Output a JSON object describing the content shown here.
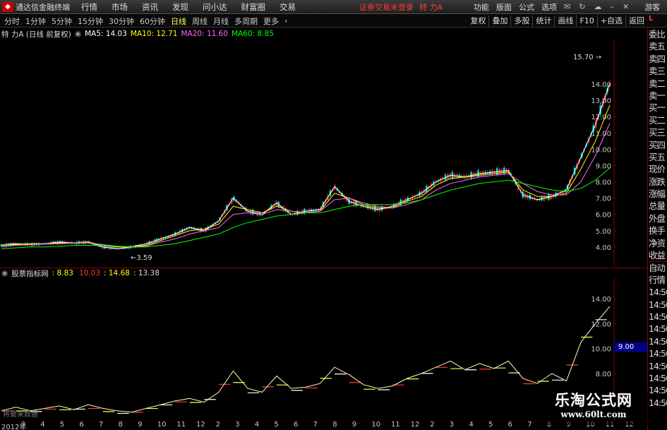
{
  "menubar": {
    "app_title": "通达信金融终端",
    "items": [
      "行情",
      "市场",
      "资讯",
      "发现",
      "问小达",
      "财富圈",
      "交易"
    ],
    "notice": "证券交易未登录",
    "stock_name": "特 力A",
    "right_items": [
      "功能",
      "版面",
      "公式",
      "选项"
    ],
    "guest": "游客"
  },
  "toolbar": {
    "periods": [
      "分时",
      "1分钟",
      "5分钟",
      "15分钟",
      "30分钟",
      "60分钟",
      "日线",
      "周线",
      "月线",
      "多周期",
      "更多"
    ],
    "active_period": "日线",
    "buttons": [
      "复权",
      "叠加",
      "多股",
      "统计",
      "画线",
      "F10",
      "+自选",
      "返回"
    ],
    "corner": "L"
  },
  "main_info": {
    "title": "特 力A (日线 前复权)",
    "ma5": "MA5: 14.03",
    "ma10": "MA10: 12.71",
    "ma20": "MA20: 11.60",
    "ma60": "MA60: 8.85"
  },
  "sub_info": {
    "title": "股票指标网",
    "v1": ": 8.83",
    "v2": "10.03",
    "v3": ": 14.68",
    "v4": ": 13.38"
  },
  "annotations": {
    "high": "15.70",
    "low": "3.59",
    "highlight": "9.00",
    "bottom_text": "将要来数据"
  },
  "colors": {
    "up": "#ff3b3b",
    "down": "#00e0e0",
    "ma5": "#ffffff",
    "ma10": "#ffff00",
    "ma20": "#ff66ff",
    "ma60": "#00ff00"
  },
  "chart_data": [
    {
      "type": "candlestick",
      "title": "特 力A (日线 前复权)",
      "ylim": [
        3.3,
        16.3
      ],
      "yticks": [
        "14.00",
        "13.00",
        "12.00",
        "11.00",
        "10.00",
        "9.00",
        "8.00",
        "7.00",
        "6.00",
        "5.00",
        "4.00"
      ],
      "series": [
        {
          "name": "MA5",
          "values": [
            4.1,
            4.2,
            4.15,
            4.2,
            4.3,
            4.25,
            4.3,
            4.0,
            3.9,
            4.0,
            4.2,
            4.5,
            4.8,
            5.2,
            5.0,
            5.6,
            7.0,
            6.2,
            6.0,
            6.7,
            6.0,
            6.2,
            6.3,
            7.7,
            6.8,
            6.5,
            6.3,
            6.5,
            6.9,
            7.3,
            8.0,
            8.4,
            8.3,
            8.5,
            8.6,
            8.7,
            7.2,
            6.9,
            7.1,
            7.5,
            9.5,
            11.5,
            14.03
          ]
        },
        {
          "name": "MA10",
          "values": [
            4.1,
            4.15,
            4.2,
            4.2,
            4.25,
            4.25,
            4.3,
            4.1,
            4.0,
            4.0,
            4.1,
            4.4,
            4.7,
            5.0,
            5.1,
            5.4,
            6.5,
            6.3,
            6.1,
            6.5,
            6.2,
            6.1,
            6.2,
            7.3,
            7.0,
            6.6,
            6.4,
            6.4,
            6.8,
            7.1,
            7.8,
            8.2,
            8.3,
            8.4,
            8.5,
            8.6,
            7.5,
            7.1,
            7.1,
            7.3,
            8.8,
            10.5,
            12.71
          ]
        },
        {
          "name": "MA20",
          "values": [
            4.0,
            4.1,
            4.15,
            4.2,
            4.2,
            4.25,
            4.25,
            4.15,
            4.05,
            4.0,
            4.05,
            4.3,
            4.5,
            4.8,
            5.0,
            5.2,
            6.0,
            6.1,
            6.0,
            6.3,
            6.2,
            6.1,
            6.2,
            6.9,
            7.0,
            6.7,
            6.5,
            6.4,
            6.6,
            6.9,
            7.5,
            7.9,
            8.1,
            8.3,
            8.4,
            8.5,
            7.9,
            7.4,
            7.2,
            7.2,
            8.0,
            9.6,
            11.6
          ]
        },
        {
          "name": "MA60",
          "values": [
            3.9,
            3.95,
            4.0,
            4.0,
            4.05,
            4.1,
            4.1,
            4.1,
            4.05,
            4.0,
            4.0,
            4.1,
            4.2,
            4.4,
            4.6,
            4.8,
            5.2,
            5.5,
            5.7,
            5.9,
            6.0,
            6.1,
            6.1,
            6.3,
            6.5,
            6.6,
            6.6,
            6.6,
            6.7,
            6.9,
            7.2,
            7.5,
            7.7,
            7.9,
            8.0,
            8.1,
            7.9,
            7.7,
            7.5,
            7.4,
            7.6,
            8.1,
            8.85
          ]
        }
      ]
    },
    {
      "type": "line",
      "title": "股票指标网",
      "ylim": [
        4.6,
        15.3
      ],
      "yticks": [
        "14.00",
        "12.00",
        "10.00",
        "8.00"
      ],
      "series": [
        {
          "name": "",
          "values": [
            5.0,
            5.3,
            5.0,
            5.2,
            5.4,
            5.1,
            5.5,
            5.2,
            5.0,
            4.9,
            5.2,
            5.5,
            5.8,
            6.0,
            5.7,
            6.5,
            8.2,
            6.8,
            6.5,
            7.8,
            6.8,
            6.9,
            7.2,
            8.5,
            7.9,
            7.1,
            6.8,
            7.0,
            7.6,
            8.0,
            8.5,
            9.0,
            8.3,
            8.8,
            8.4,
            9.0,
            7.6,
            7.2,
            8.0,
            7.4,
            10.5,
            12.0,
            13.38
          ]
        }
      ]
    }
  ],
  "sidebar": {
    "items": [
      "委比",
      "卖五",
      "卖四",
      "卖三",
      "卖二",
      "卖一",
      "买一",
      "买二",
      "买三",
      "买四",
      "买五",
      "现价",
      "涨跌",
      "涨幅",
      "总量",
      "外盘",
      "换手",
      "净资",
      "收益",
      "自动",
      "行情",
      "14:50",
      "14:50",
      "14:50",
      "14:50",
      "14:50",
      "14:50",
      "14:50",
      "14:50",
      "14:50",
      "14:50"
    ]
  },
  "dates": {
    "labels": [
      "2012年",
      "3",
      "4",
      "5",
      "6",
      "7",
      "8",
      "9",
      "10",
      "11",
      "12",
      "2",
      "3",
      "4",
      "5",
      "6",
      "7",
      "8",
      "9",
      "10",
      "11",
      "12",
      "2",
      "3",
      "4",
      "5",
      "6",
      "7",
      "8",
      "9",
      "10",
      "11",
      "12"
    ]
  }
}
